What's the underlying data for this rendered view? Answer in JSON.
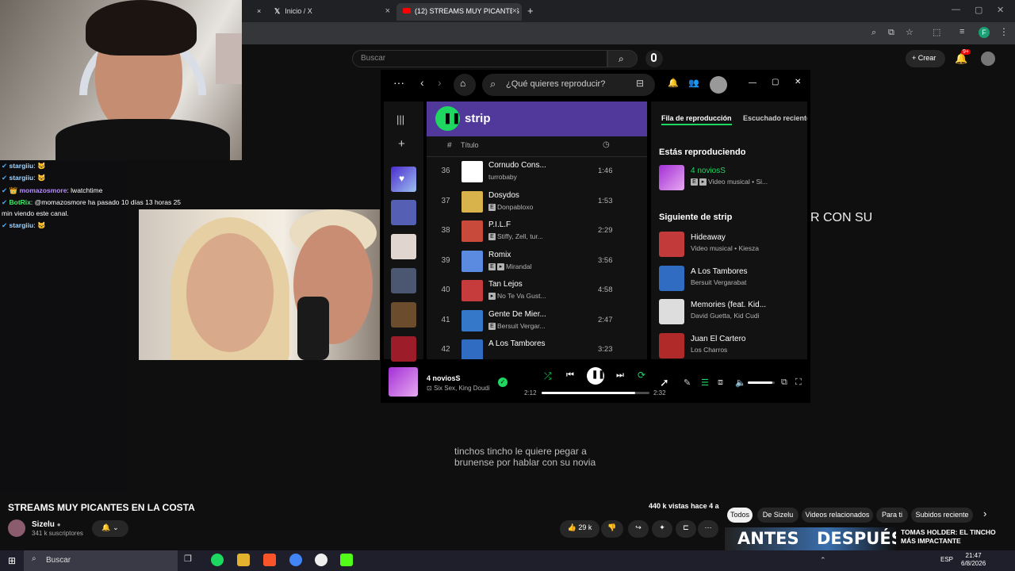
{
  "browser": {
    "tabs": [
      {
        "title": "Inicio / X",
        "icon": "x-logo-icon"
      },
      {
        "title": "(12) STREAMS MUY PICANTES E",
        "icon": "youtube-icon"
      }
    ],
    "new_tab": "+"
  },
  "stream_chat": [
    {
      "user": "stargiiu",
      "message": ""
    },
    {
      "user": "stargiiu",
      "message": ""
    },
    {
      "user": "momazosmore",
      "message": "lwatchtime"
    },
    {
      "user": "BotRix",
      "message": "@momazosmore ha pasado 10 días 13 horas 25"
    },
    {
      "user": "",
      "message": "min viendo este canal."
    },
    {
      "user": "stargiiu",
      "message": ""
    }
  ],
  "youtube": {
    "search_placeholder": "Buscar",
    "create_label": "Crear",
    "notifications_badge": "9+",
    "video_title": "STREAMS MUY PICANTES EN LA COSTA",
    "views": "440 k vistas",
    "published": "hace 4 a",
    "channel_name": "Sizelu",
    "subscribers": "341 k suscriptores",
    "likes": "29 k",
    "caption_line1": "tinchos tincho le quiere pegar a",
    "caption_line2": "brunense por hablar con su novia",
    "overlay_text": "R CON SU",
    "chips": [
      "Todos",
      "De Sizelu",
      "Videos relacionados",
      "Para ti",
      "Subidos reciente"
    ],
    "recommended": {
      "thumb_left": "ANTES",
      "thumb_right": "DESPUÉS",
      "title_line1": "TOMAS HOLDER: EL TINCHO",
      "title_line2": "MÁS IMPACTANTE"
    }
  },
  "spotify": {
    "search_placeholder": "¿Qué quieres reproducir?",
    "playlist_name": "strip",
    "col_number": "#",
    "col_title": "Título",
    "tracks": [
      {
        "n": "36",
        "title": "Cornudo Cons...",
        "artist": "turrobaby",
        "duration": "1:46",
        "explicit": false,
        "video": false,
        "color": "#ffffff"
      },
      {
        "n": "37",
        "title": "Dosydos",
        "artist": "Donpabloxo",
        "duration": "1:53",
        "explicit": true,
        "video": false,
        "color": "#d8b24a"
      },
      {
        "n": "38",
        "title": "P.I.L.F",
        "artist": "Stiffy, Zell, tur...",
        "duration": "2:29",
        "explicit": true,
        "video": false,
        "color": "#c84a3a"
      },
      {
        "n": "39",
        "title": "Romix",
        "artist": "Mirandal",
        "duration": "3:56",
        "explicit": true,
        "video": true,
        "color": "#5a8be0"
      },
      {
        "n": "40",
        "title": "Tan Lejos",
        "artist": "No Te Va Gust...",
        "duration": "4:58",
        "explicit": false,
        "video": true,
        "color": "#c63b3b"
      },
      {
        "n": "41",
        "title": "Gente De Mier...",
        "artist": "Bersuit Vergar...",
        "duration": "2:47",
        "explicit": true,
        "video": false,
        "color": "#3577c9"
      },
      {
        "n": "42",
        "title": "A Los Tambores",
        "artist": "",
        "duration": "3:23",
        "explicit": false,
        "video": false,
        "color": "#2f6cc2"
      }
    ],
    "tabs": {
      "queue": "Fila de reproducción",
      "recent": "Escuchado reciente"
    },
    "now_playing_heading": "Estás reproduciendo",
    "now_playing": {
      "title": "4 noviosS",
      "meta": "Video musical • Si..."
    },
    "next_heading": "Siguiente de strip",
    "queue": [
      {
        "title": "Hideaway",
        "artist": "Video musical • Kiesza",
        "color": "#c33a3a"
      },
      {
        "title": "A Los Tambores",
        "artist": "Bersuit Vergarabat",
        "color": "#2f6cc2"
      },
      {
        "title": "Memories (feat. Kid...",
        "artist": "David Guetta, Kid Cudi",
        "color": "#dddddd"
      },
      {
        "title": "Juan El Cartero",
        "artist": "Los Charros",
        "color": "#b02a2a"
      }
    ],
    "player": {
      "title": "4 noviosS",
      "artist": "Six Sex, King Doudi",
      "elapsed": "2:12",
      "total": "2:32",
      "progress": 0.87,
      "volume": 0.9
    },
    "accent": "#1ed760"
  },
  "taskbar": {
    "search_placeholder": "Buscar",
    "lang": "ESP",
    "time": "21:47",
    "date": "6/8/2026"
  }
}
